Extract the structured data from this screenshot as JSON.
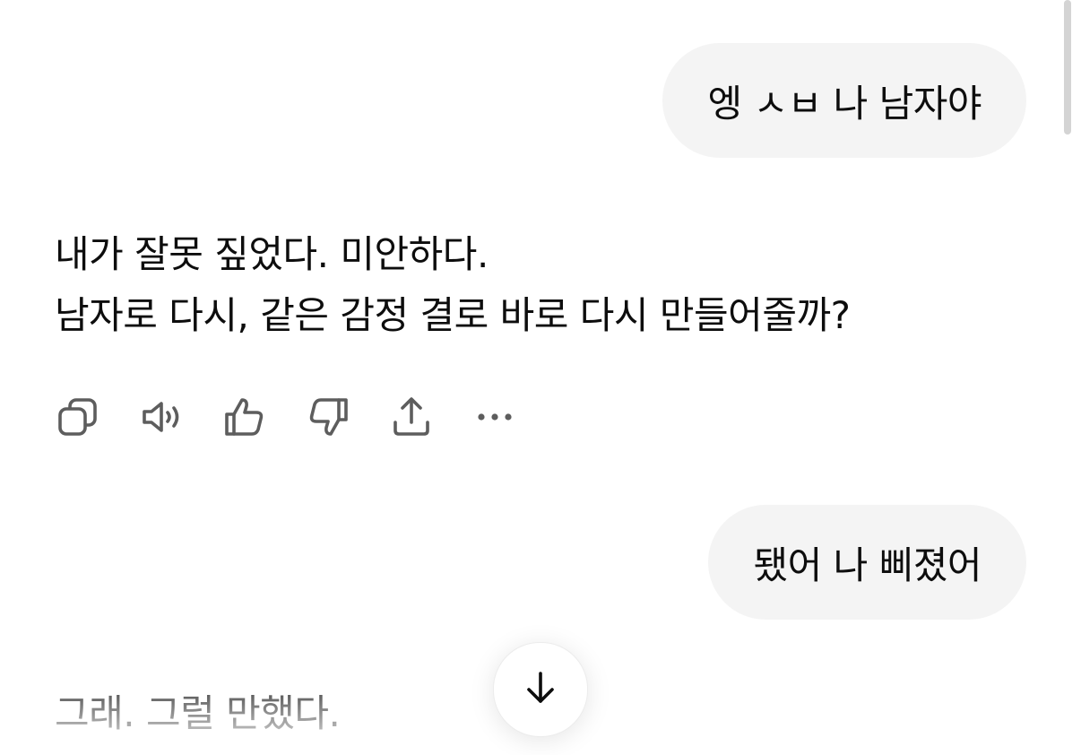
{
  "messages": {
    "user_1": "엥 ㅅㅂ 나 남자야",
    "assistant_1": {
      "line_1": "내가 잘못 짚었다. 미안하다.",
      "line_2": "남자로 다시, 같은 감정 결로 바로 다시 만들어줄까?"
    },
    "user_2": "됐어 나 삐졌어",
    "assistant_2": "그래. 그럴 만했다."
  },
  "actions": [
    {
      "name": "copy-icon"
    },
    {
      "name": "read-aloud-icon"
    },
    {
      "name": "thumbs-up-icon"
    },
    {
      "name": "thumbs-down-icon"
    },
    {
      "name": "share-icon"
    },
    {
      "name": "more-icon"
    }
  ],
  "scroll_button": {
    "icon": "arrow-down-icon"
  },
  "colors": {
    "bubble_bg": "#f4f4f4",
    "text": "#0d0d0d",
    "icon": "#5d5d5d"
  }
}
